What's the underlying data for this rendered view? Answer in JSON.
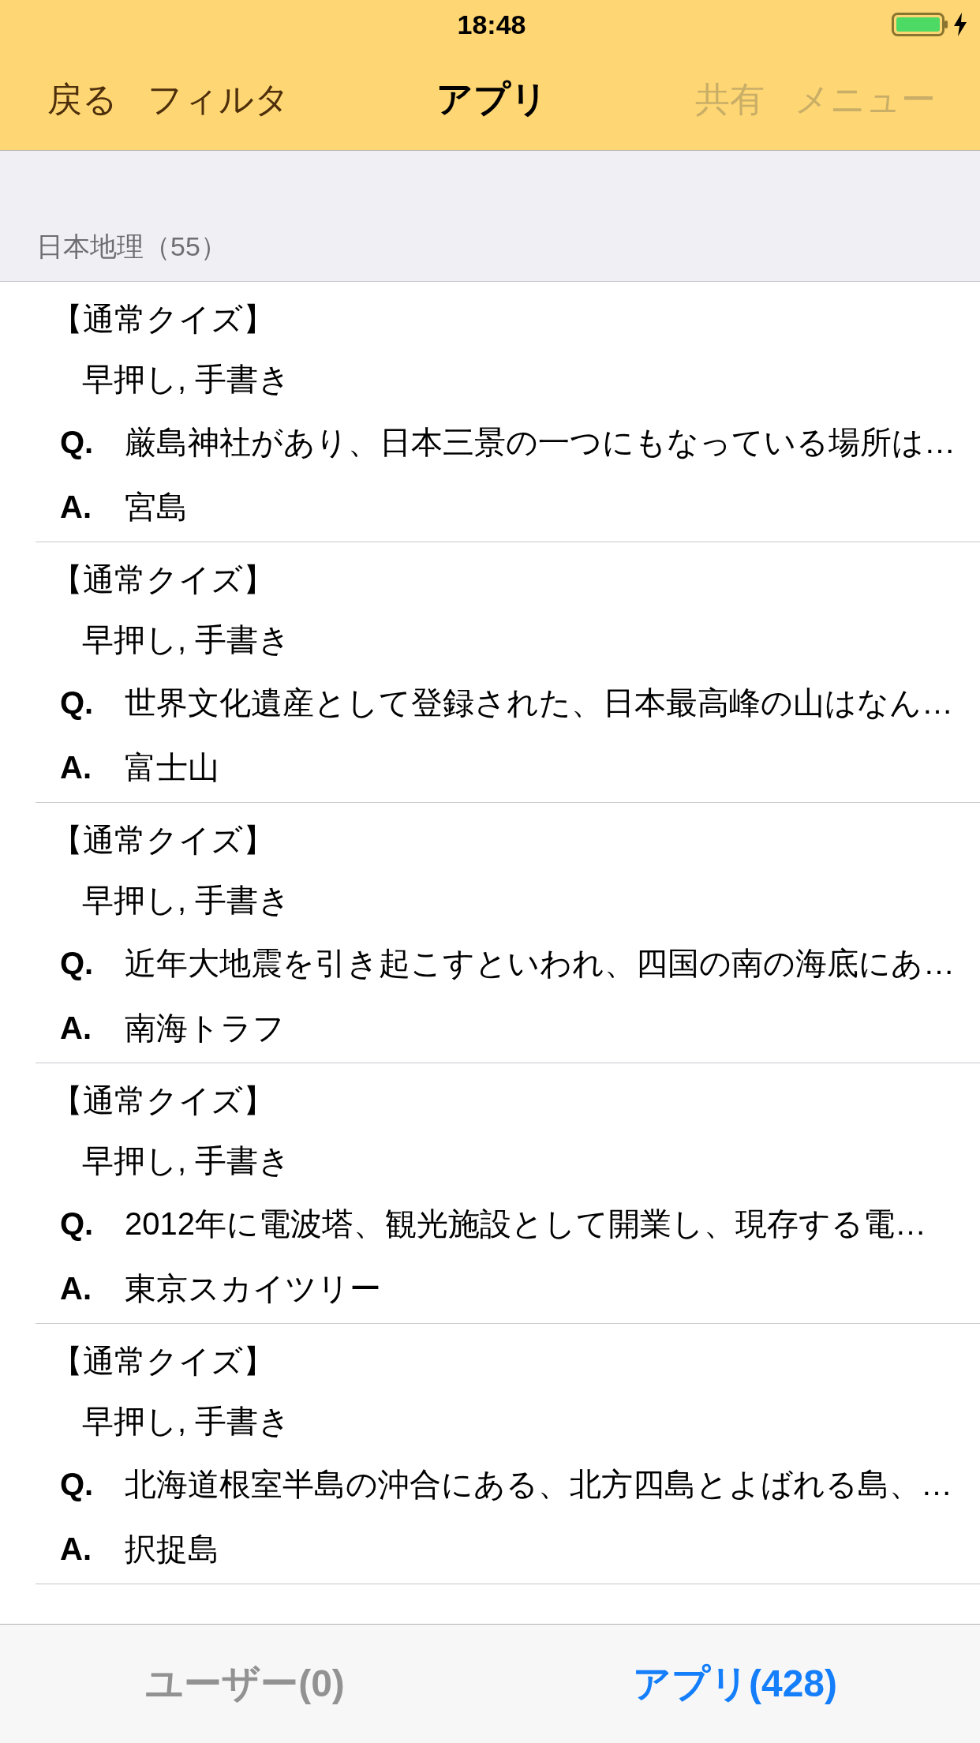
{
  "status_bar": {
    "time": "18:48",
    "charging": true
  },
  "nav_bar": {
    "left": [
      {
        "label": "戻る",
        "disabled": false
      },
      {
        "label": "フィルタ",
        "disabled": false
      }
    ],
    "title": "アプリ",
    "right": [
      {
        "label": "共有",
        "disabled": true
      },
      {
        "label": "メニュー",
        "disabled": true
      }
    ]
  },
  "section": {
    "header": "日本地理（55）"
  },
  "quizzes": [
    {
      "type": "【通常クイズ】",
      "modes": "早押し, 手書き",
      "q_label": "Q.",
      "question": "厳島神社があり、日本三景の一つにもなっている場所は…",
      "a_label": "A.",
      "answer": "宮島"
    },
    {
      "type": "【通常クイズ】",
      "modes": "早押し, 手書き",
      "q_label": "Q.",
      "question": "世界文化遺産として登録された、日本最高峰の山はなん…",
      "a_label": "A.",
      "answer": "富士山"
    },
    {
      "type": "【通常クイズ】",
      "modes": "早押し, 手書き",
      "q_label": "Q.",
      "question": "近年大地震を引き起こすといわれ、四国の南の海底にあ…",
      "a_label": "A.",
      "answer": "南海トラフ"
    },
    {
      "type": "【通常クイズ】",
      "modes": "早押し, 手書き",
      "q_label": "Q.",
      "question": "2012年に電波塔、観光施設として開業し、現存する電…",
      "a_label": "A.",
      "answer": "東京スカイツリー"
    },
    {
      "type": "【通常クイズ】",
      "modes": "早押し, 手書き",
      "q_label": "Q.",
      "question": "北海道根室半島の沖合にある、北方四島とよばれる島、…",
      "a_label": "A.",
      "answer": "択捉島"
    }
  ],
  "tab_bar": [
    {
      "label": "ユーザー(0)",
      "selected": false
    },
    {
      "label": "アプリ(428)",
      "selected": true
    }
  ]
}
